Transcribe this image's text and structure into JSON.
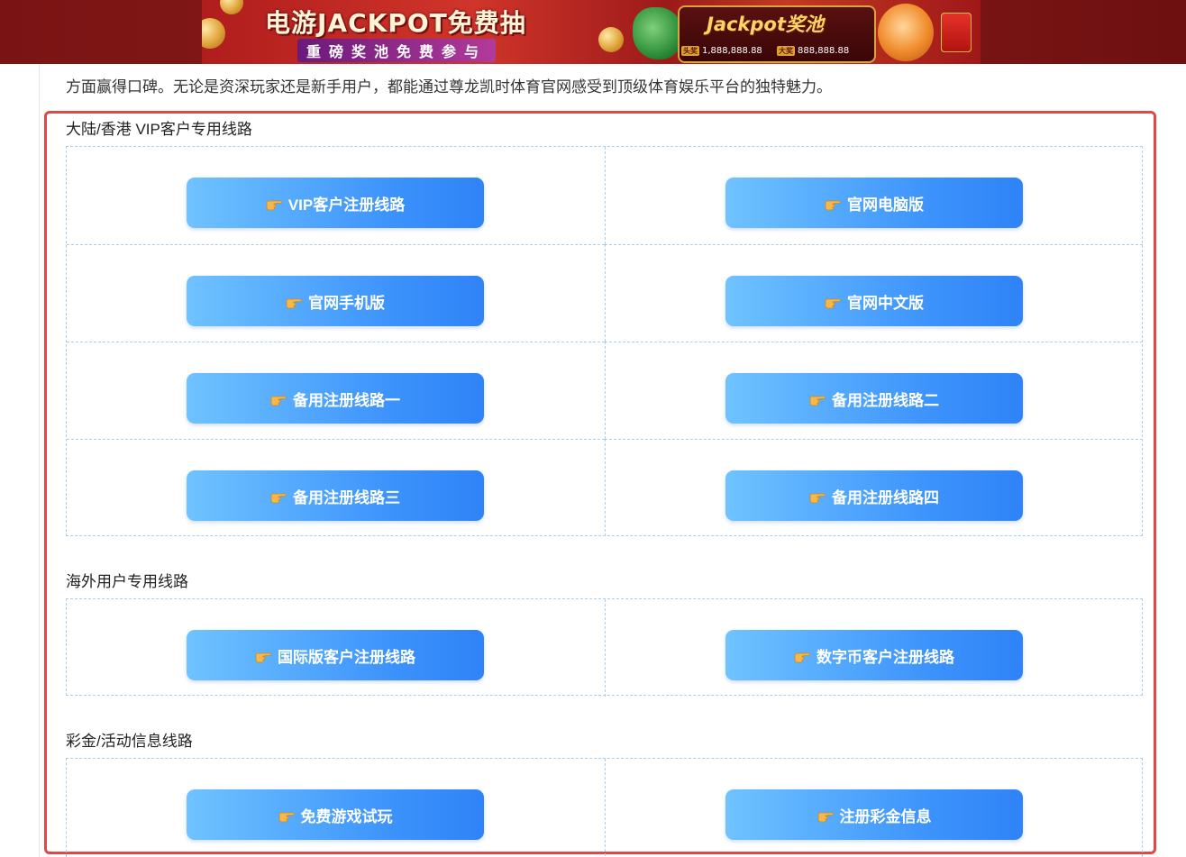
{
  "banner": {
    "title": "电游JACKPOT免费抽",
    "subtitle": "重磅奖池免费参与",
    "jackpot_title": "Jackpot奖池",
    "prize_first_tag": "头奖",
    "prize_first_value": "1,888,888.88",
    "prize_big_tag": "大奖",
    "prize_big_value": "888,888.88"
  },
  "intro_text": "方面赢得口碑。无论是资深玩家还是新手用户，都能通过尊龙凯时体育官网感受到顶级体育娱乐平台的独特魅力。",
  "sections": [
    {
      "title": "大陆/香港 VIP客户专用线路",
      "buttons": [
        "VIP客户注册线路",
        "官网电脑版",
        "官网手机版",
        "官网中文版",
        "备用注册线路一",
        "备用注册线路二",
        "备用注册线路三",
        "备用注册线路四"
      ]
    },
    {
      "title": "海外用户专用线路",
      "buttons": [
        "国际版客户注册线路",
        "数字币客户注册线路"
      ]
    },
    {
      "title": "彩金/活动信息线路",
      "buttons": [
        "免费游戏试玩",
        "注册彩金信息"
      ]
    }
  ],
  "colors": {
    "button_start": "#6fc3ff",
    "button_end": "#2f83f7",
    "highlight_border": "#e04848",
    "banner_red": "#8b1a1a"
  },
  "icons": {
    "button_icon": "pointing-hand-icon"
  }
}
